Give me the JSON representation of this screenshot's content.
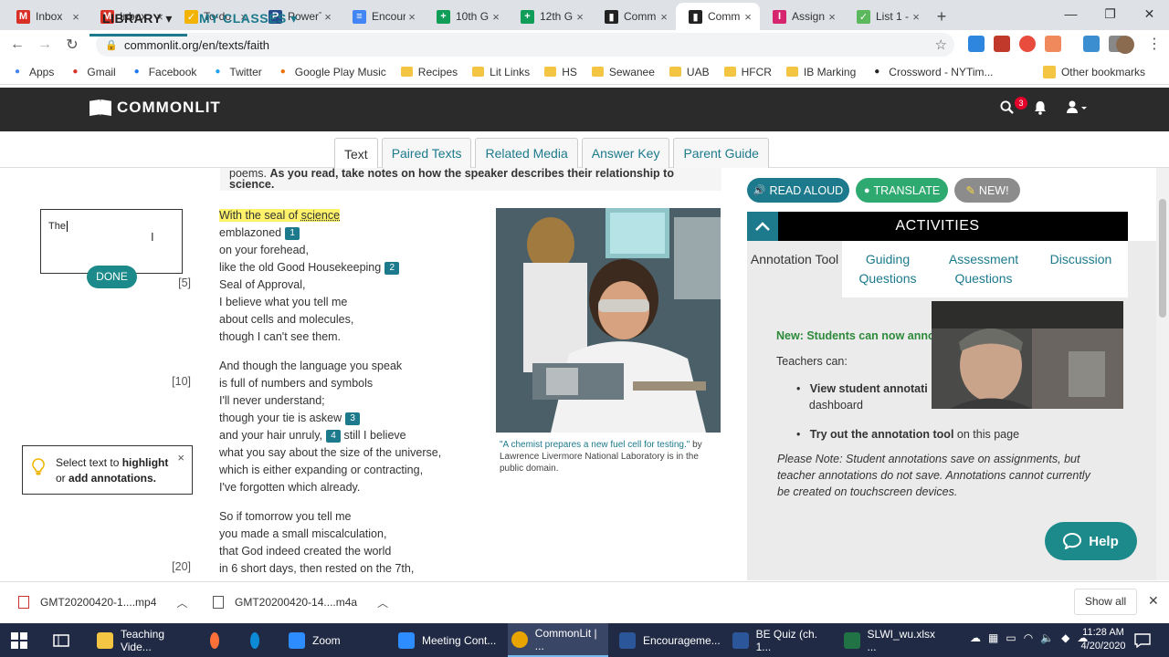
{
  "browser": {
    "tabs": [
      {
        "label": "Inbox",
        "icon": "gmail-icon",
        "color": "#d93025",
        "glyph": "M"
      },
      {
        "label": "Inbox",
        "icon": "gmail-icon",
        "color": "#d93025",
        "glyph": "M"
      },
      {
        "label": "To-do",
        "icon": "todo-icon",
        "color": "#f2b400",
        "glyph": "✓"
      },
      {
        "label": "PowerT",
        "icon": "powerteacher-icon",
        "color": "#244b8a",
        "glyph": "P"
      },
      {
        "label": "Encour",
        "icon": "google-docs-icon",
        "color": "#4285f4",
        "glyph": "≡"
      },
      {
        "label": "10th G",
        "icon": "google-sheets-icon",
        "color": "#0f9d58",
        "glyph": "+"
      },
      {
        "label": "12th G",
        "icon": "google-sheets-icon",
        "color": "#0f9d58",
        "glyph": "+"
      },
      {
        "label": "Comm",
        "icon": "commonlit-icon",
        "color": "#222222",
        "glyph": "▮"
      },
      {
        "label": "Comm",
        "icon": "commonlit-icon",
        "color": "#222222",
        "glyph": "▮"
      },
      {
        "label": "Assign",
        "icon": "assignment-icon",
        "color": "#d6246e",
        "glyph": "I"
      },
      {
        "label": "List 1 -",
        "icon": "list-icon",
        "color": "#5cb85c",
        "glyph": "✓"
      }
    ],
    "active_tab": 8,
    "url": "commonlit.org/en/texts/faith",
    "bookmarks": [
      {
        "label": "Apps",
        "icon": "apps-icon",
        "color": "#4285f4"
      },
      {
        "label": "Gmail",
        "icon": "gmail-icon",
        "color": "#d93025"
      },
      {
        "label": "Facebook",
        "icon": "facebook-icon",
        "color": "#1877f2"
      },
      {
        "label": "Twitter",
        "icon": "twitter-icon",
        "color": "#1da1f2"
      },
      {
        "label": "Google Play Music",
        "icon": "play-music-icon",
        "color": "#ef6c00"
      },
      {
        "label": "Recipes",
        "icon": "folder-icon",
        "color": "#f4c542"
      },
      {
        "label": "Lit Links",
        "icon": "folder-icon",
        "color": "#f4c542"
      },
      {
        "label": "HS",
        "icon": "folder-icon",
        "color": "#f4c542"
      },
      {
        "label": "Sewanee",
        "icon": "folder-icon",
        "color": "#f4c542"
      },
      {
        "label": "UAB",
        "icon": "folder-icon",
        "color": "#f4c542"
      },
      {
        "label": "HFCR",
        "icon": "folder-icon",
        "color": "#f4c542"
      },
      {
        "label": "IB Marking",
        "icon": "folder-icon",
        "color": "#f4c542"
      },
      {
        "label": "Crossword - NYTim...",
        "icon": "nyt-icon",
        "color": "#222222"
      }
    ],
    "other_bookmarks": "Other bookmarks"
  },
  "app": {
    "brand": "COMMONLIT",
    "notification_count": "3",
    "nav": {
      "library": "LIBRARY",
      "classes": "MY CLASSES"
    },
    "text_tabs": [
      "Text",
      "Paired Texts",
      "Related Media",
      "Answer Key",
      "Parent Guide"
    ],
    "active_text_tab": 0,
    "intro_text": "poems.",
    "intro_bold": "As you read, take notes on how the speaker describes their relationship to science.",
    "note_text": "The",
    "done_label": "DONE",
    "tip": {
      "pre": "Select text to",
      "bold1": "highlight",
      "mid": "or",
      "bold2": "add annotations."
    },
    "line_numbers": [
      "[5]",
      "[10]",
      "[20]"
    ],
    "stanza1_line1": "With the seal of",
    "stanza1_word": "science",
    "stanza1": [
      "emblazoned",
      "on your forehead,",
      "like the old Good Housekeeping",
      "Seal of Approval,",
      "I believe what you tell me",
      "about cells and molecules,",
      "though I can't see them."
    ],
    "stanza2": [
      "And though the language you speak",
      "is full of numbers and symbols",
      "I'll never understand;",
      "though your tie is askew",
      "and your hair unruly,",
      "what you say about the size of the universe,",
      "which is either expanding or contracting,",
      "I've forgotten which already."
    ],
    "stanza2_after4": "still I believe",
    "stanza3": [
      "So if tomorrow you tell me",
      "you made a small miscalculation,",
      "that God indeed created the world",
      "in 6 short days, then rested on the 7th,"
    ],
    "footnotes": [
      "1",
      "2",
      "3",
      "4"
    ],
    "caption_link": "\"A chemist prepares a new fuel cell for testing.\"",
    "caption_rest": "by Lawrence Livermore National Laboratory is in the public domain.",
    "buttons": {
      "read_aloud": "READ ALOUD",
      "translate": "TRANSLATE",
      "new": "NEW!"
    },
    "activities_title": "ACTIVITIES",
    "activity_tabs": [
      "Annotation Tool",
      "Guiding Questions",
      "Assessment Questions",
      "Discussion"
    ],
    "panel": {
      "new_line": "New: Students can now anno",
      "teachers_can": "Teachers can:",
      "bullet1_bold": "View student annotati",
      "bullet1_rest": "dashboard",
      "bullet2_bold": "Try out the annotation tool",
      "bullet2_rest": "on this page",
      "note": "Please Note: Student annotations save on assignments, but teacher annotations do not save. Annotations cannot currently be created on touchscreen devices."
    },
    "help_label": "Help"
  },
  "downloads": {
    "items": [
      "GMT20200420-1....mp4",
      "GMT20200420-14....m4a"
    ],
    "show_all": "Show all"
  },
  "taskbar": {
    "items": [
      {
        "label": "Teaching Vide...",
        "icon": "file-explorer-icon",
        "color": "#f4c542"
      },
      {
        "label": "",
        "icon": "firefox-icon",
        "color": "#ff7139"
      },
      {
        "label": "",
        "icon": "edge-icon",
        "color": "#0c8ad6"
      },
      {
        "label": "Zoom",
        "icon": "zoom-icon",
        "color": "#2d8cff"
      },
      {
        "label": "Meeting Cont...",
        "icon": "zoom-icon",
        "color": "#2d8cff"
      },
      {
        "label": "CommonLit | ...",
        "icon": "chrome-icon",
        "color": "#e8a400"
      },
      {
        "label": "Encourageme...",
        "icon": "word-icon",
        "color": "#2b579a"
      },
      {
        "label": "BE Quiz (ch. 1...",
        "icon": "word-icon",
        "color": "#2b579a"
      },
      {
        "label": "SLWI_wu.xlsx ...",
        "icon": "excel-icon",
        "color": "#217346"
      }
    ],
    "time": "11:28 AM",
    "date": "4/20/2020"
  },
  "colors": {
    "accent": "#1c7a8c",
    "green": "#2eaa70",
    "help": "#1c8a8a"
  }
}
